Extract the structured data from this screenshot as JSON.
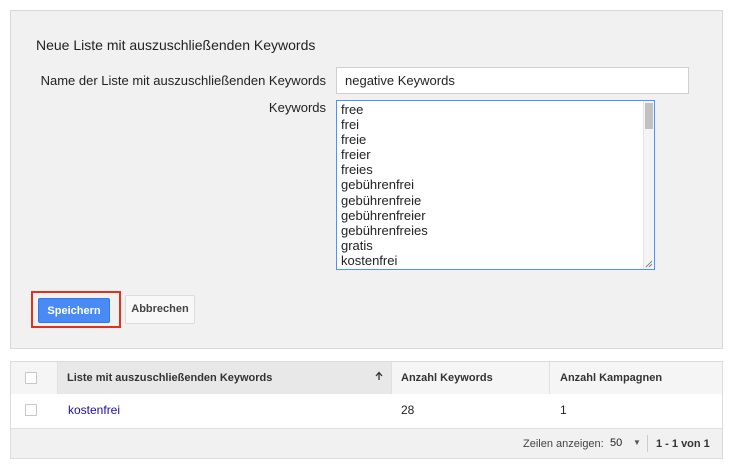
{
  "form": {
    "title": "Neue Liste mit auszuschließenden Keywords",
    "name_label": "Name der Liste mit auszuschließenden Keywords",
    "name_value": "negative Keywords",
    "keywords_label": "Keywords",
    "keywords": [
      "free",
      "frei",
      "freie",
      "freier",
      "freies",
      "gebührenfrei",
      "gebührenfreie",
      "gebührenfreier",
      "gebührenfreies",
      "gratis",
      "kostenfrei"
    ],
    "save_label": "Speichern",
    "cancel_label": "Abbrechen"
  },
  "table": {
    "headers": {
      "name": "Liste mit auszuschließenden Keywords",
      "keywords_count": "Anzahl Keywords",
      "campaigns_count": "Anzahl Kampagnen"
    },
    "rows": [
      {
        "name": "kostenfrei",
        "keywords_count": "28",
        "campaigns_count": "1"
      }
    ],
    "footer": {
      "rows_label": "Zeilen anzeigen:",
      "rows_value": "50",
      "range": "1 - 1 von 1"
    }
  },
  "colors": {
    "accent_blue": "#4a8af4",
    "highlight_red": "#e0301e",
    "link": "#1a0dab"
  },
  "icons": [
    "sort-up-arrow-icon",
    "dropdown-caret-icon",
    "resize-grip-icon"
  ]
}
